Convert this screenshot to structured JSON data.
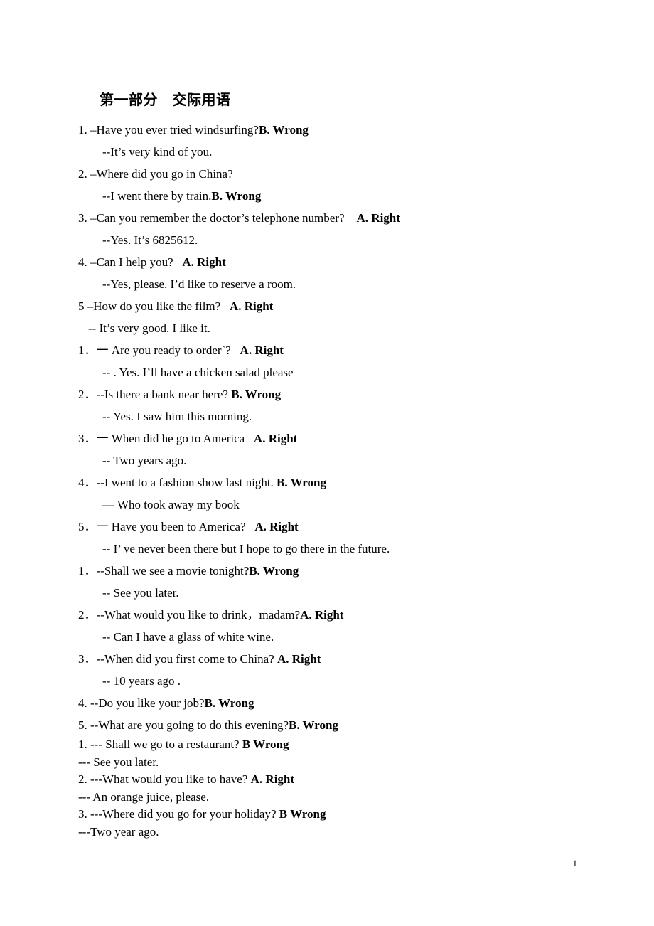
{
  "document": {
    "heading": "第一部分　交际用语",
    "page_number": "1"
  },
  "groups": [
    {
      "id": "group-1",
      "spacing": "loose",
      "lines": [
        {
          "kind": "question",
          "indent": "flush",
          "text": "1. –Have you ever tried windsurfing?",
          "answer": "B. Wrong"
        },
        {
          "kind": "answer",
          "indent": "normal",
          "text": "--It’s very kind of you.",
          "answer": ""
        },
        {
          "kind": "question",
          "indent": "flush",
          "text": "2. –Where did you go in China?",
          "answer": ""
        },
        {
          "kind": "answer",
          "indent": "normal",
          "text": "--I went there by train.",
          "answer": "B. Wrong"
        },
        {
          "kind": "question",
          "indent": "flush",
          "text": "3. –Can you remember the doctor’s telephone number?    ",
          "answer": "A. Right"
        },
        {
          "kind": "answer",
          "indent": "normal",
          "text": "--Yes. It’s 6825612.",
          "answer": ""
        },
        {
          "kind": "question",
          "indent": "flush",
          "text": "4. –Can I help you?   ",
          "answer": "A. Right"
        },
        {
          "kind": "answer",
          "indent": "normal",
          "text": "--Yes, please. I’d like to reserve a room.",
          "answer": ""
        },
        {
          "kind": "question",
          "indent": "flush",
          "text": "5 –How do you like the film?   ",
          "answer": "A. Right"
        },
        {
          "kind": "answer",
          "indent": "narrow",
          "text": "-- It’s very good. I like it.",
          "answer": ""
        }
      ]
    },
    {
      "id": "group-2",
      "spacing": "loose",
      "lines": [
        {
          "kind": "question",
          "indent": "flush",
          "text": "1．一 Are you ready to order`?   ",
          "answer": "A. Right"
        },
        {
          "kind": "answer",
          "indent": "normal",
          "text": "-- . Yes. I’ll have a chicken salad please",
          "answer": ""
        },
        {
          "kind": "question",
          "indent": "flush",
          "text": "2．--Is there a bank near here? ",
          "answer": "B. Wrong"
        },
        {
          "kind": "answer",
          "indent": "normal",
          "text": "-- Yes. I saw him this morning.",
          "answer": ""
        },
        {
          "kind": "question",
          "indent": "flush",
          "text": "3．一 When did he go to America   ",
          "answer": "A. Right"
        },
        {
          "kind": "answer",
          "indent": "normal",
          "text": "-- Two years ago.",
          "answer": ""
        },
        {
          "kind": "question",
          "indent": "flush",
          "text": "4．--I went to a fashion show last night. ",
          "answer": "B. Wrong"
        },
        {
          "kind": "answer",
          "indent": "normal",
          "text": "— Who took away my book",
          "answer": ""
        },
        {
          "kind": "question",
          "indent": "flush",
          "text": "5．一 Have you been to America?   ",
          "answer": "A. Right"
        },
        {
          "kind": "answer",
          "indent": "normal",
          "text": "-- I’ ve never been there but I hope to go there in the future.",
          "answer": ""
        }
      ]
    },
    {
      "id": "group-3",
      "spacing": "loose",
      "lines": [
        {
          "kind": "question",
          "indent": "flush",
          "text": "1．--Shall we see a movie tonight?",
          "answer": "B. Wrong"
        },
        {
          "kind": "answer",
          "indent": "normal",
          "text": "-- See you later.",
          "answer": ""
        },
        {
          "kind": "question",
          "indent": "flush",
          "text": "2．--What would you like to drink，madam?",
          "answer": "A. Right"
        },
        {
          "kind": "answer",
          "indent": "normal",
          "text": "-- Can I have a glass of white wine.",
          "answer": ""
        },
        {
          "kind": "question",
          "indent": "flush",
          "text": "3．--When did you first come to China? ",
          "answer": "A. Right"
        },
        {
          "kind": "answer",
          "indent": "normal",
          "text": "-- 10 years ago .",
          "answer": ""
        },
        {
          "kind": "question",
          "indent": "flush",
          "text": "4. --Do you like your job?",
          "answer": "B. Wrong"
        },
        {
          "kind": "question",
          "indent": "flush",
          "text": "5. --What are you going to do this evening?",
          "answer": "B. Wrong"
        }
      ]
    },
    {
      "id": "group-4",
      "spacing": "tight",
      "lines": [
        {
          "kind": "question",
          "indent": "flush",
          "text": "1. --- Shall we go to a restaurant? ",
          "answer": "B Wrong"
        },
        {
          "kind": "answer",
          "indent": "flush",
          "text": "--- See you later.",
          "answer": ""
        },
        {
          "kind": "question",
          "indent": "flush",
          "text": "2. ---What would you like to have? ",
          "answer": "A. Right"
        },
        {
          "kind": "answer",
          "indent": "flush",
          "text": "--- An orange juice, please.",
          "answer": ""
        },
        {
          "kind": "question",
          "indent": "flush",
          "text": "3. ---Where did you go for your holiday? ",
          "answer": "B Wrong"
        },
        {
          "kind": "answer",
          "indent": "flush",
          "text": "---Two year ago.",
          "answer": ""
        }
      ]
    }
  ]
}
